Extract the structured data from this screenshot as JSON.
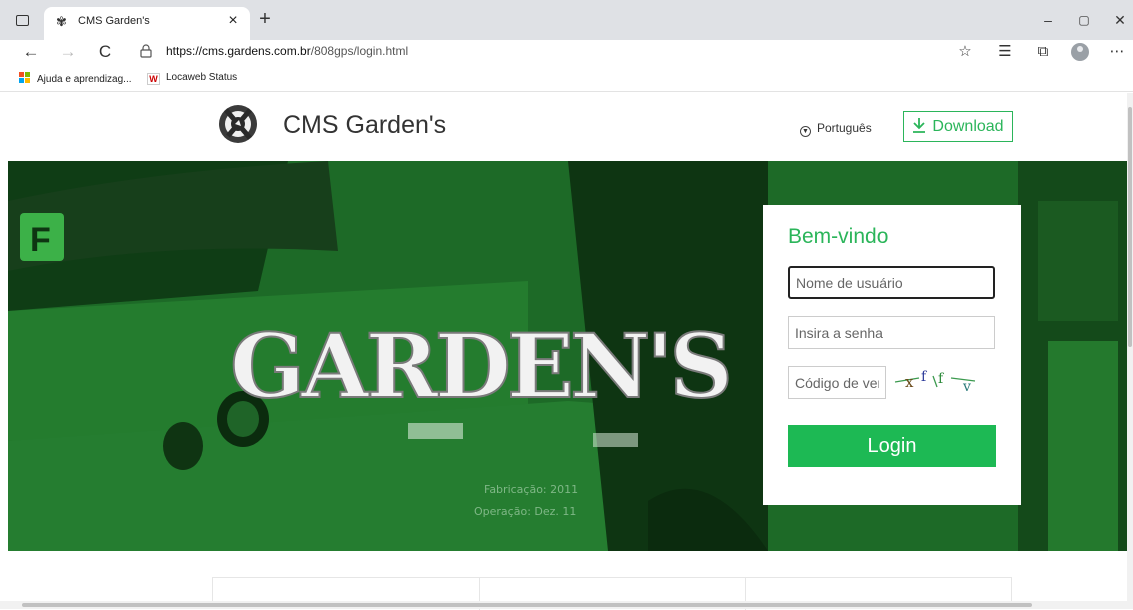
{
  "browser": {
    "tab_title": "CMS Garden's",
    "tab_close": "×",
    "new_tab": "+",
    "url_host": "https://cms.gardens.com.br",
    "url_path": "/808gps/login.html",
    "window_controls": {
      "minimize": "–",
      "restore": "▢",
      "close": "✕"
    },
    "nav": {
      "back": "←",
      "forward": "→",
      "reload": "C"
    }
  },
  "bookmarks": [
    {
      "label": "Ajuda e aprendizag...",
      "icon": "microsoft-icon"
    },
    {
      "label": "Locaweb Status",
      "icon": "w-icon"
    }
  ],
  "header": {
    "site_title": "CMS Garden's",
    "language": "Português",
    "download_label": "Download"
  },
  "hero": {
    "brand_text": "GARDEN'S",
    "sign_text": [
      "Fabricação: 2011",
      "Operação: Dez. 11"
    ]
  },
  "login": {
    "welcome": "Bem-vindo",
    "username_placeholder": "Nome de usuário",
    "password_placeholder": "Insira a senha",
    "captcha_placeholder": "Código de verificação",
    "button_label": "Login"
  },
  "colors": {
    "accent": "#2bb55a",
    "login_button": "#1db954",
    "hero_green": "#1e6f29"
  }
}
